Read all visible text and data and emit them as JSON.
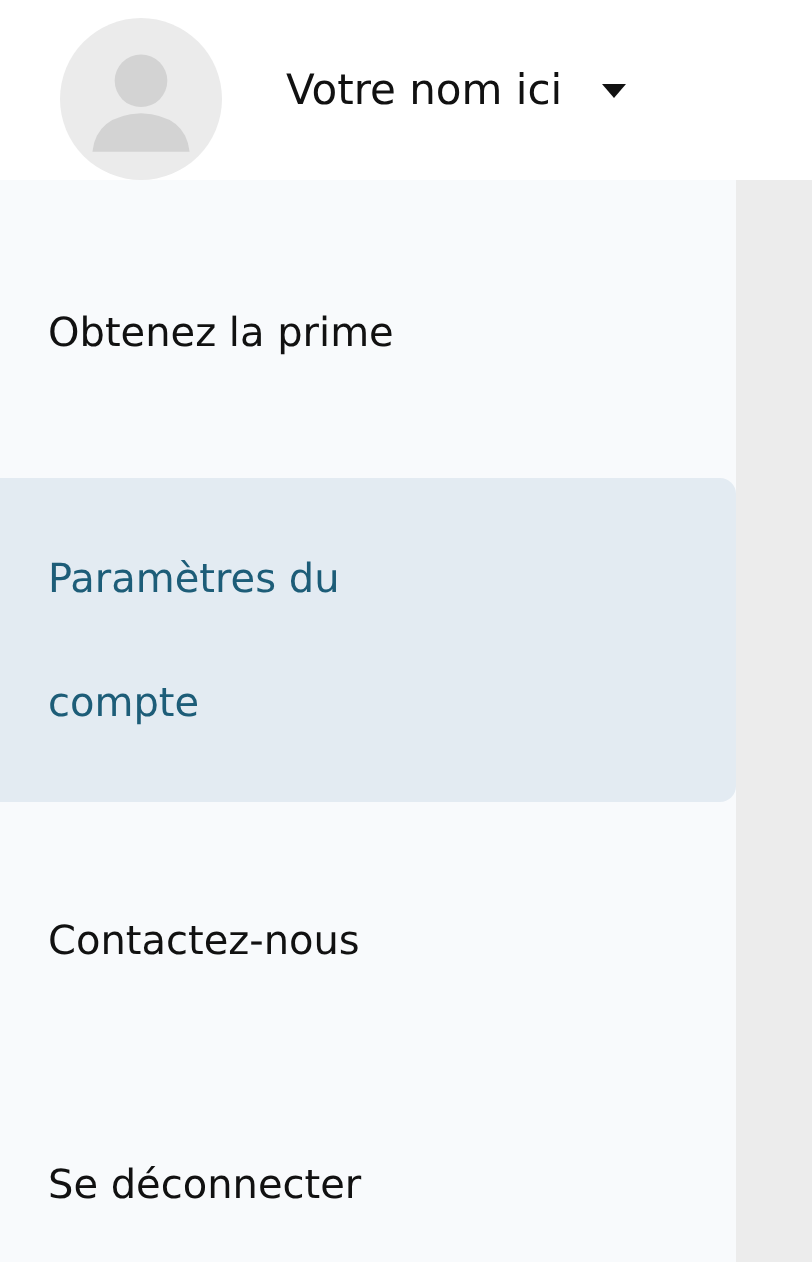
{
  "user": {
    "name": "Votre nom ici"
  },
  "menu": [
    {
      "label": "Obtenez la prime",
      "selected": false
    },
    {
      "label": "Paramètres du compte",
      "selected": true
    },
    {
      "label": "Contactez-nous",
      "selected": false
    },
    {
      "label": "Se déconnecter",
      "selected": false
    }
  ]
}
